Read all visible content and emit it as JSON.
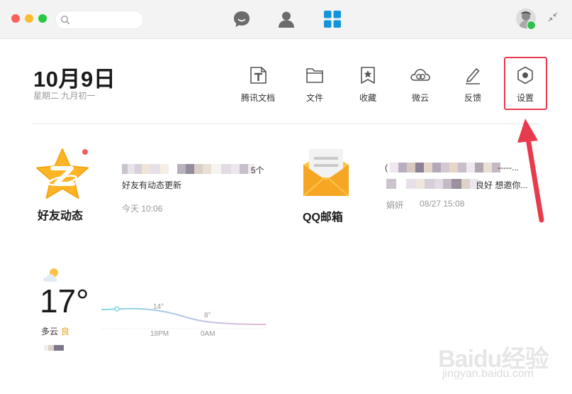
{
  "window": {
    "search": {
      "placeholder": "",
      "value": ""
    },
    "nav": [
      {
        "icon": "chat-bubble-icon"
      },
      {
        "icon": "contacts-icon"
      },
      {
        "icon": "apps-grid-icon",
        "active": true
      }
    ]
  },
  "header": {
    "date": "10月9日",
    "subdate": "星期二  九月初一"
  },
  "toolbar": [
    {
      "id": "tencent-docs",
      "label": "腾讯文档",
      "icon": "document-icon"
    },
    {
      "id": "files",
      "label": "文件",
      "icon": "folder-icon"
    },
    {
      "id": "favorites",
      "label": "收藏",
      "icon": "bookmark-star-icon"
    },
    {
      "id": "weiyun",
      "label": "微云",
      "icon": "cloud-icon"
    },
    {
      "id": "feedback",
      "label": "反馈",
      "icon": "pencil-icon"
    },
    {
      "id": "settings",
      "label": "设置",
      "icon": "hexagon-gear-icon",
      "highlighted": true
    }
  ],
  "friends_feed": {
    "title": "好友动态",
    "count_suffix": "5个",
    "summary": "好友有动态更新",
    "time": "今天 10:06"
  },
  "qq_mail": {
    "title": "QQ邮箱",
    "preview_prefix": "(",
    "preview_suffix": "-----...",
    "preview_line2_suffix": "良好 想邀你...",
    "sender": "娟妍",
    "time": "08/27 15:08"
  },
  "weather": {
    "temperature": "17°",
    "condition": "多云",
    "air_quality": "良",
    "forecast": {
      "point_labels": [
        "14°",
        "8°"
      ],
      "time_labels": [
        "18PM",
        "0AM"
      ]
    }
  },
  "watermark": {
    "brand": "Baidu经验",
    "url": "jingyan.baidu.com"
  },
  "colors": {
    "accent": "#1296db",
    "highlight_red": "#e83a4d",
    "qzone_yellow": "#fdb526",
    "mail_orange": "#f7a624",
    "online_green": "#2fc04c"
  }
}
